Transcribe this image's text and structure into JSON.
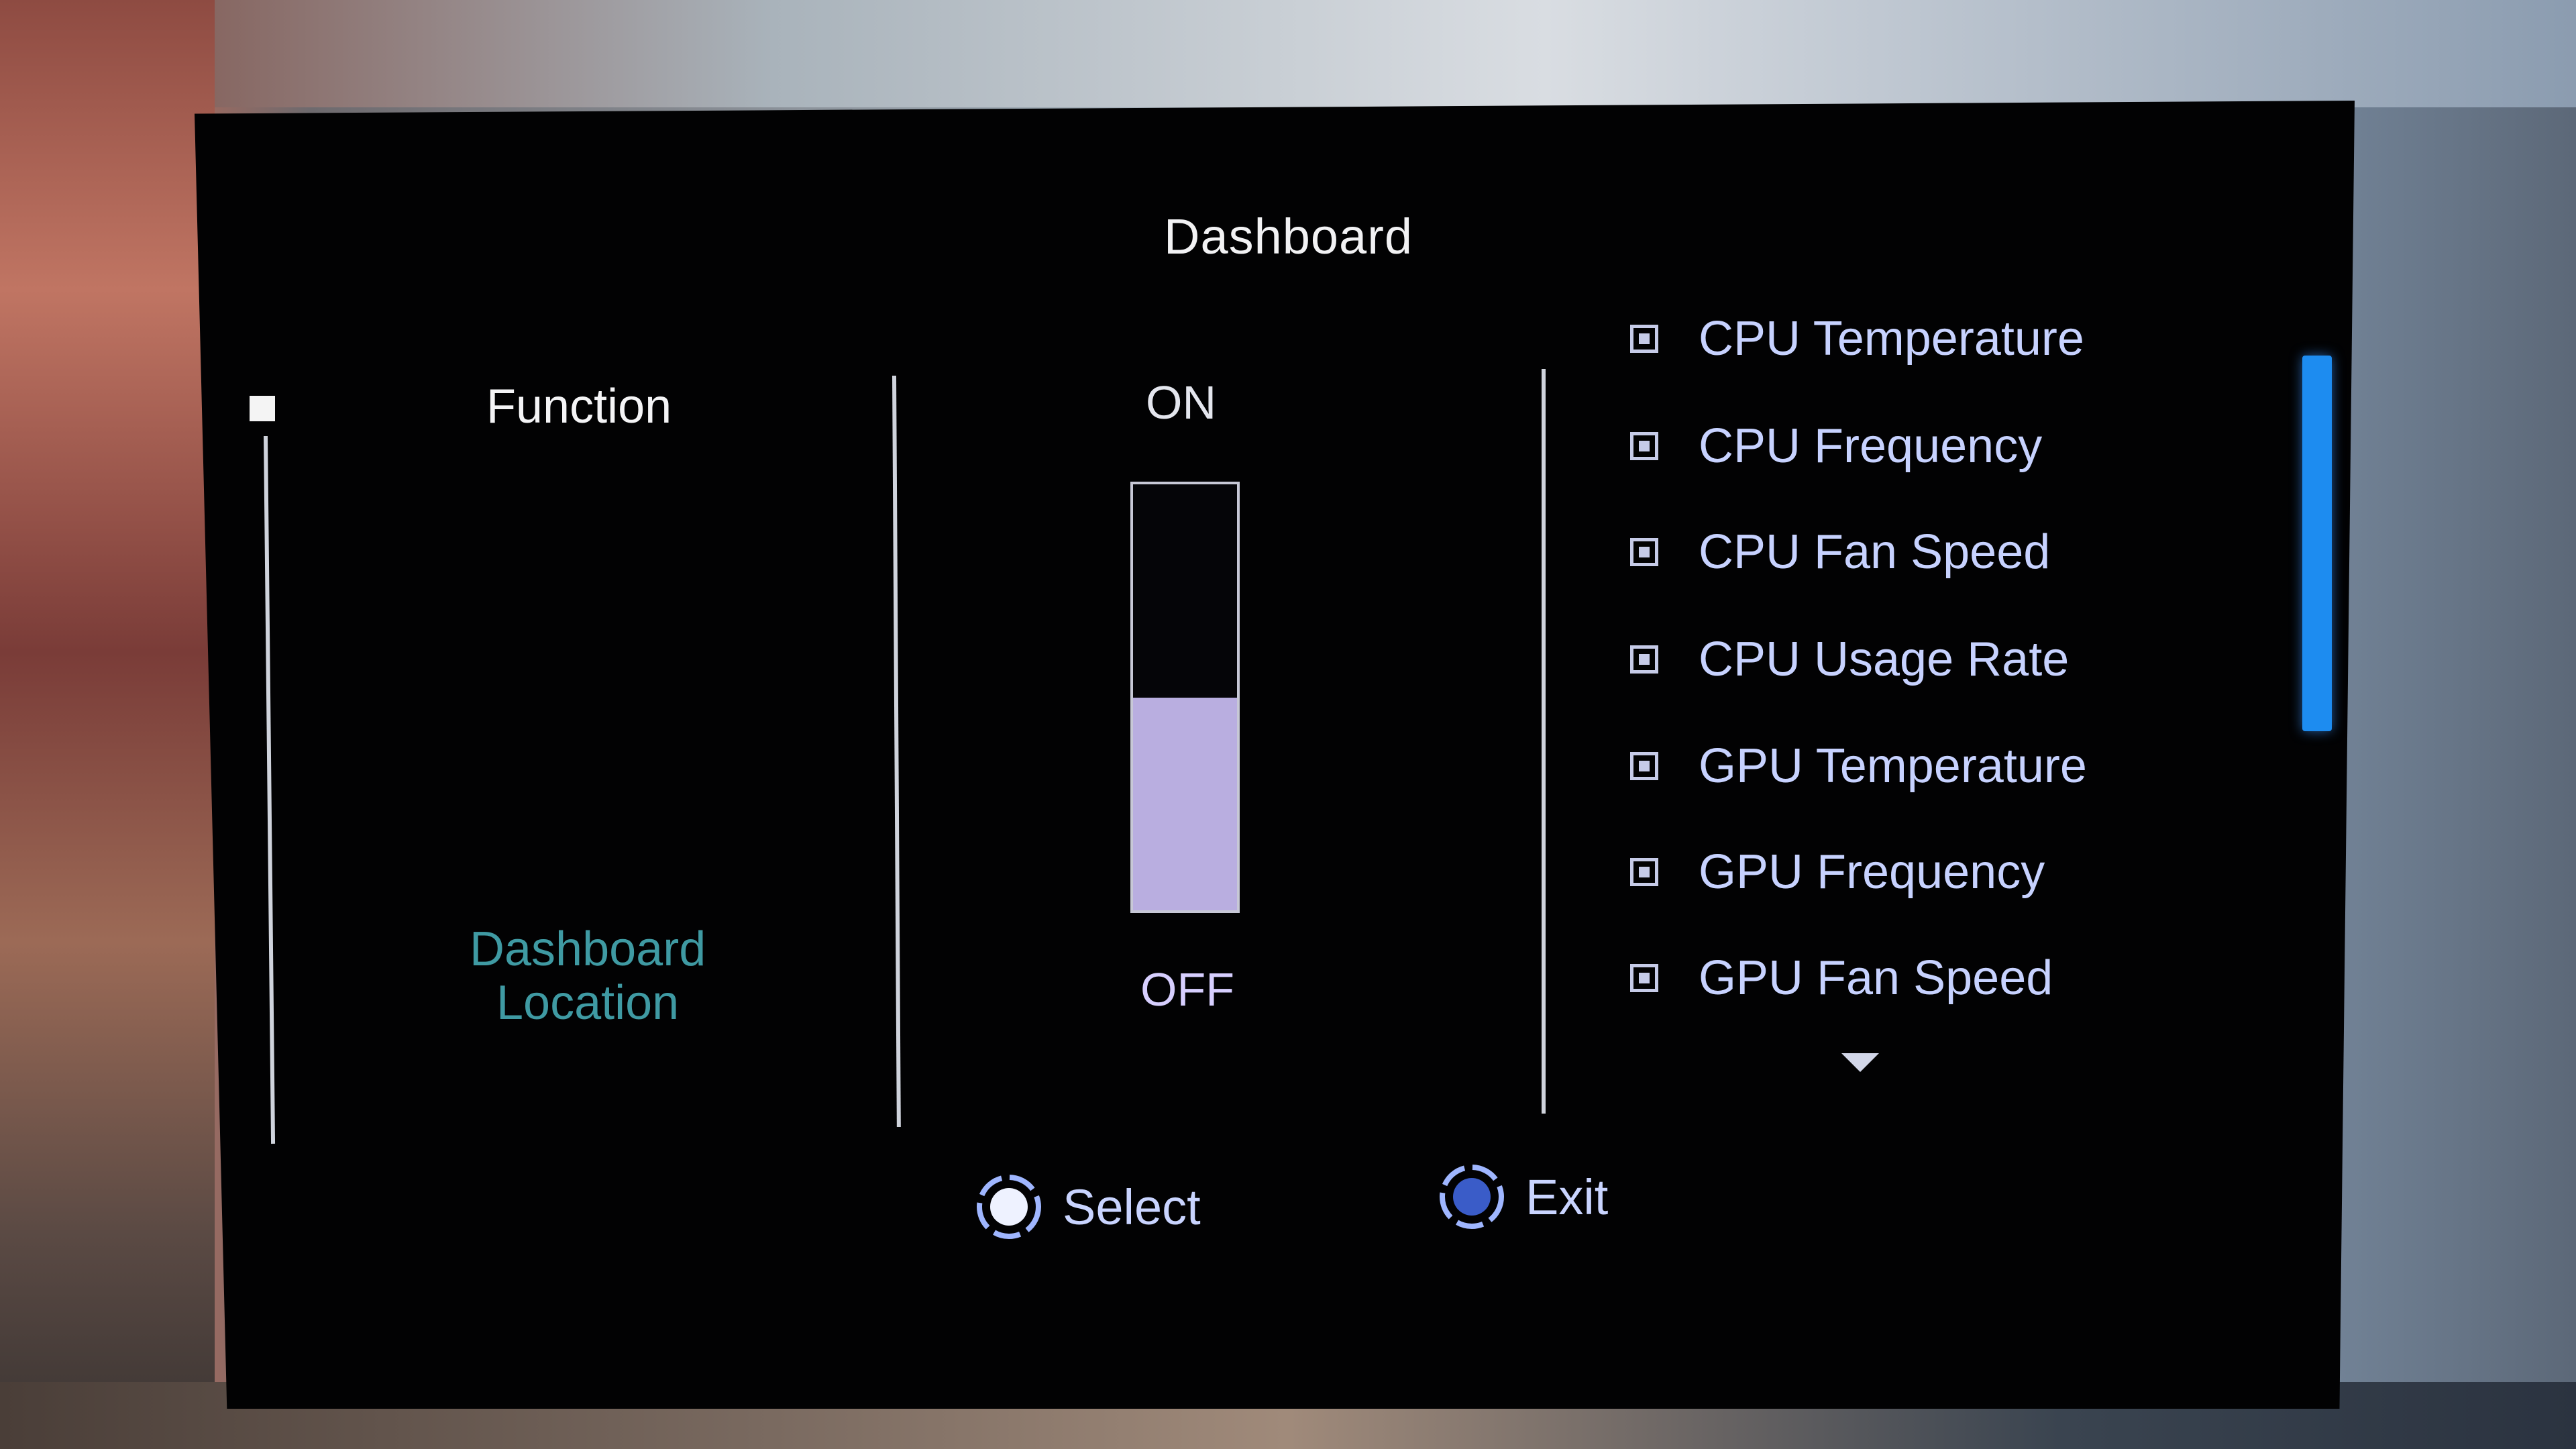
{
  "osd": {
    "title": "Dashboard",
    "left_menu": {
      "items": [
        {
          "label": "Function",
          "state": "selected"
        },
        {
          "label_line1": "Dashboard",
          "label_line2": "Location",
          "state": "inactive"
        }
      ]
    },
    "toggle": {
      "on_label": "ON",
      "off_label": "OFF",
      "current": "OFF",
      "fill_fraction": 0.5
    },
    "options": {
      "items": [
        {
          "label": "CPU Temperature",
          "checked": true
        },
        {
          "label": "CPU Frequency",
          "checked": true
        },
        {
          "label": "CPU Fan Speed",
          "checked": true
        },
        {
          "label": "CPU Usage Rate",
          "checked": true
        },
        {
          "label": "GPU Temperature",
          "checked": true
        },
        {
          "label": "GPU Frequency",
          "checked": true
        },
        {
          "label": "GPU Fan Speed",
          "checked": true
        }
      ],
      "more_indicator": "chevron-down",
      "scroll_position": 0.0,
      "scroll_visible_fraction": 0.4
    },
    "hints": {
      "select_label": "Select",
      "exit_label": "Exit"
    },
    "colors": {
      "accent_blue": "#1d8cf0",
      "list_text": "#c7d2ff",
      "inactive_teal": "#3f9aa3",
      "toggle_fill": "#b9aee0"
    }
  }
}
